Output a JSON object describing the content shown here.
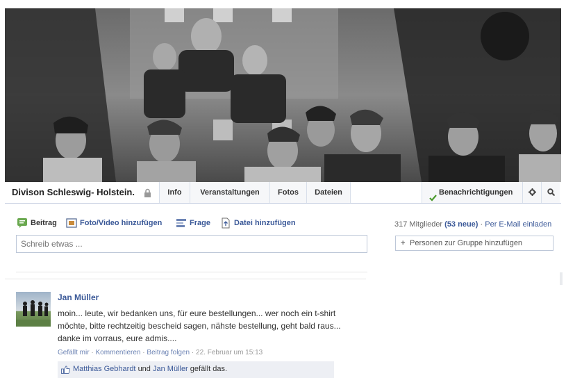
{
  "group": {
    "name": "Divison Schleswig- Holstein.",
    "tabs": [
      "Info",
      "Veranstaltungen",
      "Fotos",
      "Dateien"
    ],
    "notifications_label": "Benachrichtigungen"
  },
  "composer": {
    "tabs": [
      "Beitrag",
      "Foto/Video hinzufügen",
      "Frage",
      "Datei hinzufügen"
    ],
    "placeholder": "Schreib etwas ..."
  },
  "sidebar": {
    "members": "317 Mitglieder",
    "new_members": "(53 neue)",
    "separator": "·",
    "email_invite": "Per E-Mail einladen",
    "add_people": "Personen zur Gruppe hinzufügen"
  },
  "post": {
    "author": "Jan Müller",
    "text": "moin... leute, wir bedanken uns, für eure bestellungen... wer noch ein t-shirt möchte, bitte rechtzeitig bescheid sagen, nähste bestellung, geht bald raus... danke im vorraus, eure admis....",
    "actions": {
      "like": "Gefällt mir",
      "comment": "Kommentieren",
      "follow": "Beitrag folgen",
      "timestamp": "22. Februar um 15:13",
      "dot": "·"
    },
    "likes": {
      "user1": "Matthias Gebhardt",
      "and": "und",
      "user2": "Jan Müller",
      "suffix": "gefällt das."
    }
  },
  "colors": {
    "link": "#3b5998",
    "border": "#bdc7d8",
    "likes_bg": "#edeff4"
  }
}
